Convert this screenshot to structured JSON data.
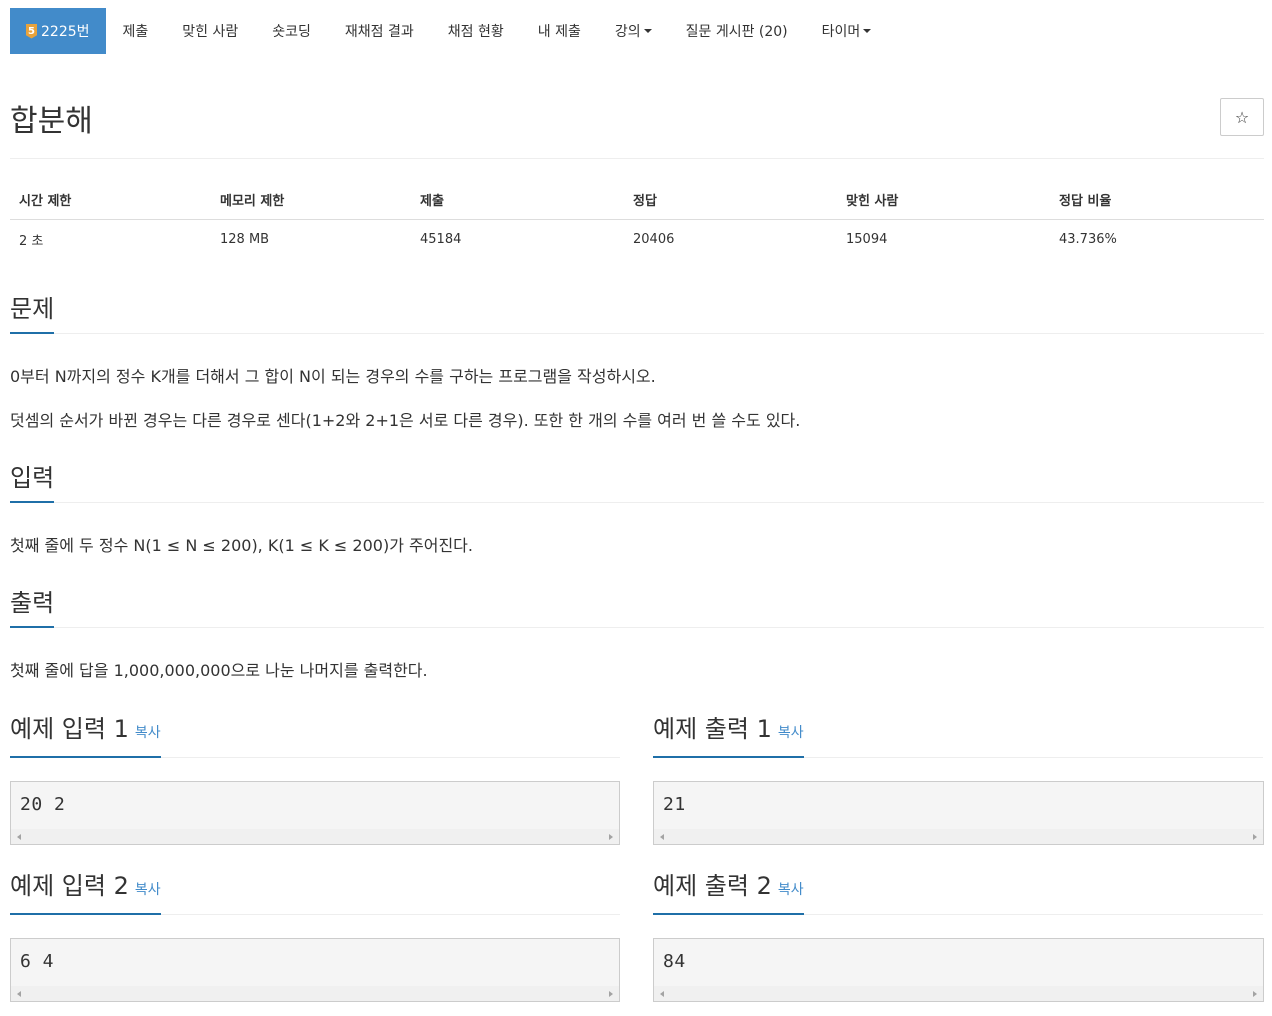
{
  "nav": {
    "problem_level": "5",
    "problem_id": "2225번",
    "items": [
      "제출",
      "맞힌 사람",
      "숏코딩",
      "재채점 결과",
      "채점 현황",
      "내 제출",
      "강의",
      "질문 게시판 (20)",
      "타이머"
    ]
  },
  "title": "합분해",
  "star": "☆",
  "info": {
    "headers": [
      "시간 제한",
      "메모리 제한",
      "제출",
      "정답",
      "맞힌 사람",
      "정답 비율"
    ],
    "values": [
      "2 초",
      "128 MB",
      "45184",
      "20406",
      "15094",
      "43.736%"
    ]
  },
  "sections": {
    "problem": {
      "title": "문제",
      "paragraphs": [
        "0부터 N까지의 정수 K개를 더해서 그 합이 N이 되는 경우의 수를 구하는 프로그램을 작성하시오.",
        "덧셈의 순서가 바뀐 경우는 다른 경우로 센다(1+2와 2+1은 서로 다른 경우). 또한 한 개의 수를 여러 번 쓸 수도 있다."
      ]
    },
    "input": {
      "title": "입력",
      "text": "첫째 줄에 두 정수 N(1 ≤ N ≤ 200), K(1 ≤ K ≤ 200)가 주어진다."
    },
    "output": {
      "title": "출력",
      "text": "첫째 줄에 답을 1,000,000,000으로 나눈 나머지를 출력한다."
    }
  },
  "samples": {
    "copy_label": "복사",
    "in1_title": "예제 입력 1",
    "out1_title": "예제 출력 1",
    "in2_title": "예제 입력 2",
    "out2_title": "예제 출력 2",
    "in1": "20 2",
    "out1": "21",
    "in2": "6 4",
    "out2": "84"
  }
}
